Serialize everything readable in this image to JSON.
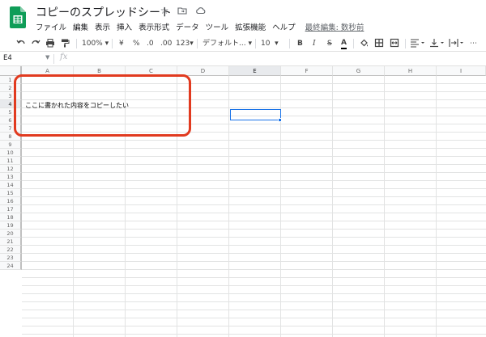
{
  "app": {
    "doc_title": "コピーのスプレッドシート",
    "brand_color": "#0f9d58",
    "accent_color": "#1a73e8",
    "annotation_color": "#e13a1f"
  },
  "menu": {
    "items": [
      "ファイル",
      "編集",
      "表示",
      "挿入",
      "表示形式",
      "データ",
      "ツール",
      "拡張機能",
      "ヘルプ"
    ],
    "last_edit": "最終編集: 数秒前"
  },
  "toolbar": {
    "zoom": "100%",
    "currency": "¥",
    "percent": "%",
    "decimal_decrease": ".0",
    "decimal_increase": ".00",
    "more_formats": "123",
    "font": "デフォルト...",
    "font_size": "10",
    "bold": "B",
    "italic": "I",
    "strike": "S",
    "text_color": "A",
    "icons": [
      "undo-icon",
      "redo-icon",
      "print-icon",
      "paint-format-icon",
      "fill-color-icon",
      "borders-icon",
      "merge-icon",
      "align-icon",
      "valign-icon",
      "wrap-icon"
    ]
  },
  "formula_bar": {
    "cell_ref": "E4",
    "fx": "fx",
    "value": ""
  },
  "sheet": {
    "columns": [
      "A",
      "B",
      "C",
      "D",
      "E",
      "F",
      "G",
      "H",
      "I"
    ],
    "rows": [
      "1",
      "2",
      "3",
      "4",
      "5",
      "6",
      "7",
      "8",
      "9",
      "10",
      "11",
      "12",
      "13",
      "14",
      "15",
      "16",
      "17",
      "18",
      "19",
      "20",
      "21",
      "22",
      "23",
      "24"
    ],
    "selected_cell": "E4",
    "cells": {
      "A3": "ここに書かれた内容をコピーしたい"
    }
  }
}
